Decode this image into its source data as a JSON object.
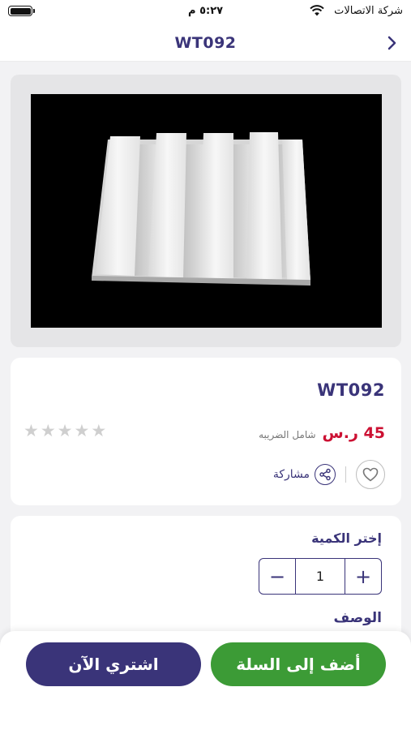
{
  "status_bar": {
    "carrier": "شركة الاتصالات",
    "time": "٥:٢٧ م"
  },
  "header": {
    "title": "WT092",
    "back_icon": "chevron-right-icon"
  },
  "product": {
    "name": "WT092",
    "price": "45 ر.س",
    "tax_note": "شامل الضريبه",
    "rating": 0,
    "rating_max": 5,
    "share_label": "مشاركة",
    "image_description": "white slatted PVC wall panel on black background"
  },
  "quantity": {
    "title": "إختر الكمية",
    "value": "1",
    "minus": "−",
    "plus": "+"
  },
  "description": {
    "title": "الوصف"
  },
  "actions": {
    "add_to_cart": "أضف إلى السلة",
    "buy_now": "اشتري الآن"
  },
  "colors": {
    "brand": "#3a3479",
    "price": "#cc1133",
    "add_to_cart": "#3c9b36"
  }
}
